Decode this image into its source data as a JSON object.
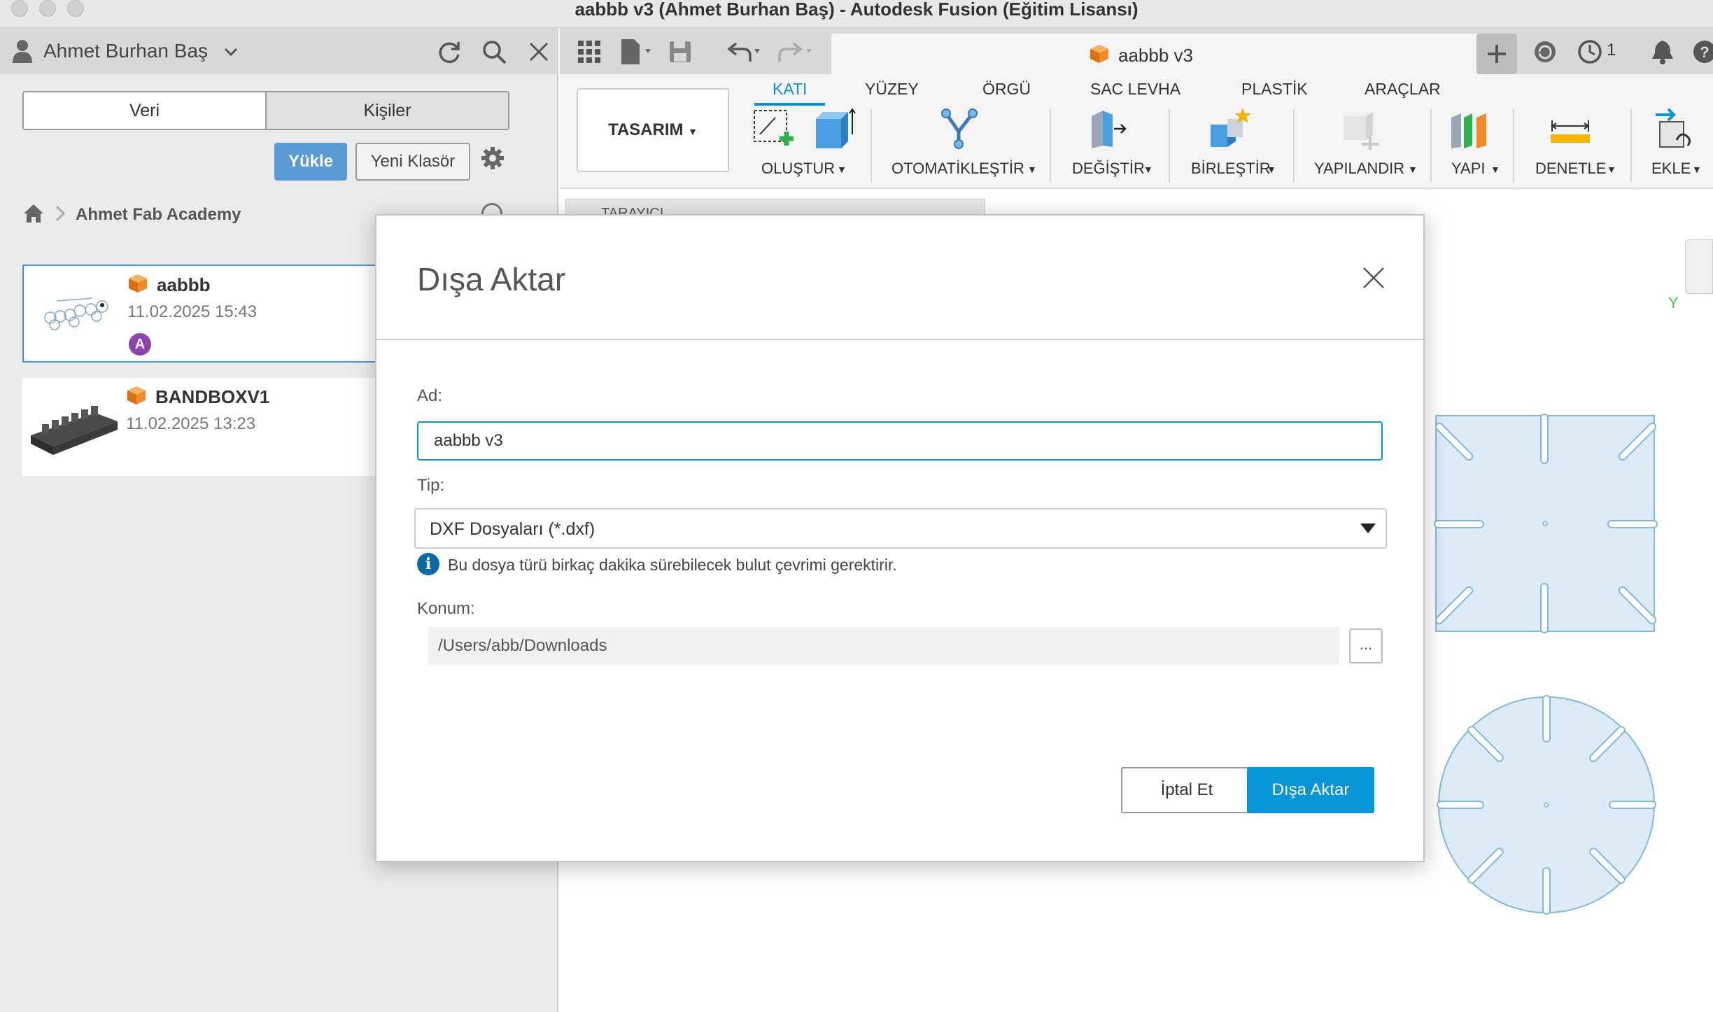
{
  "window": {
    "title": "aabbb v3 (Ahmet Burhan Baş) - Autodesk Fusion (Eğitim Lisansı)"
  },
  "data_panel": {
    "user_name": "Ahmet Burhan Baş",
    "toggle": {
      "data_label": "Veri",
      "people_label": "Kişiler"
    },
    "upload_label": "Yükle",
    "new_folder_label": "Yeni Klasör",
    "breadcrumb": "Ahmet Fab Academy",
    "files": [
      {
        "name": "aabbb",
        "date": "11.02.2025 15:43",
        "avatar": "A"
      },
      {
        "name": "BANDBOXV1",
        "date": "11.02.2025 13:23"
      }
    ]
  },
  "document_tab": {
    "label": "aabbb v3",
    "notification_count": "1"
  },
  "ribbon": {
    "workspace": "TASARIM",
    "tabs": [
      "KATI",
      "YÜZEY",
      "ÖRGÜ",
      "SAC LEVHA",
      "PLASTİK",
      "ARAÇLAR"
    ],
    "active_tab": "KATI",
    "groups": [
      "OLUŞTUR",
      "OTOMATİKLEŞTİR",
      "DEĞİŞTİR",
      "BİRLEŞTİR",
      "YAPILANDIR",
      "YAPI",
      "DENETLE",
      "EKLE"
    ]
  },
  "canvas": {
    "browser_label": "TARAYICI",
    "axis_label": "Y"
  },
  "export_dialog": {
    "title": "Dışa Aktar",
    "name_label": "Ad:",
    "name_value": "aabbb v3",
    "type_label": "Tip:",
    "type_value": "DXF Dosyaları (*.dxf)",
    "info_text": "Bu dosya türü birkaç dakika sürebilecek bulut çevrimi gerektirir.",
    "location_label": "Konum:",
    "location_value": "/Users/abb/Downloads",
    "browse_label": "...",
    "cancel_label": "İptal Et",
    "export_label": "Dışa Aktar"
  },
  "colors": {
    "accent": "#0696d7",
    "upload_button": "#5b9bd5",
    "sketch_fill": "#dcebf6",
    "sketch_stroke": "#7fb9dd",
    "avatar": "#8e44ad"
  }
}
